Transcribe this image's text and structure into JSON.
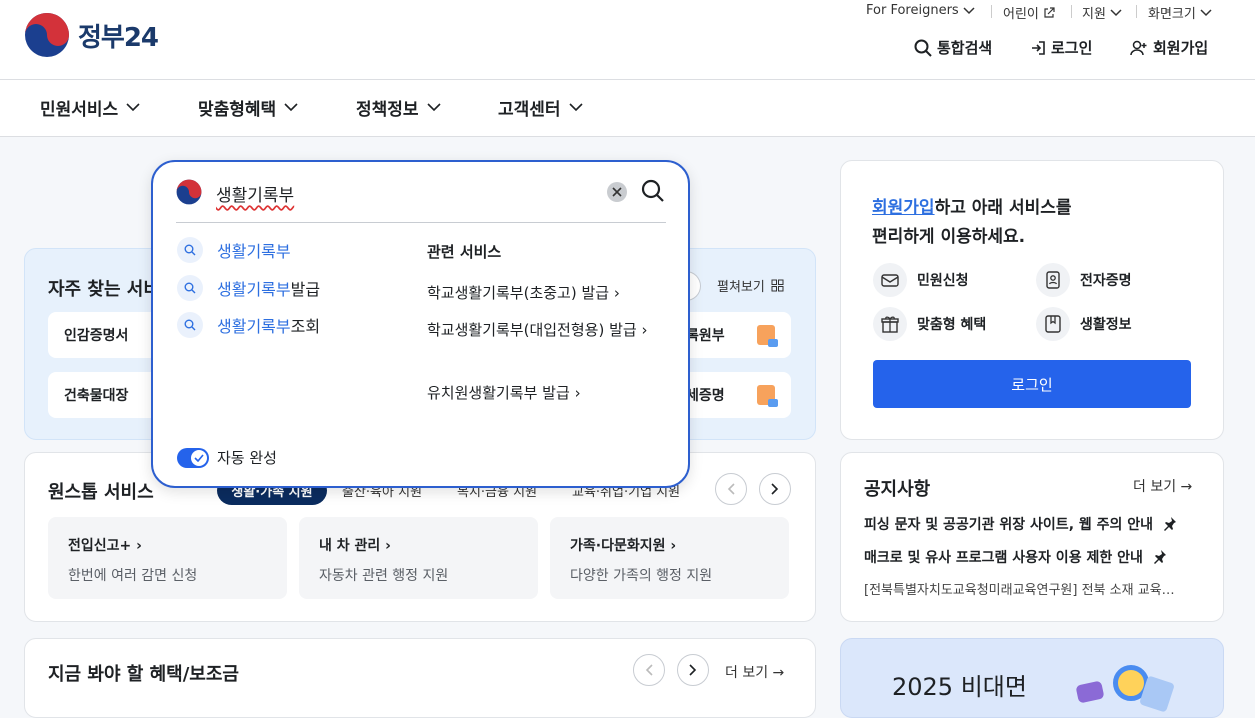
{
  "header": {
    "logo_text": "정부24",
    "util": {
      "foreigners": "For Foreigners",
      "kids": "어린이",
      "support": "지원",
      "screen_size": "화면크기"
    },
    "search_label": "통합검색",
    "login_label": "로그인",
    "signup_label": "회원가입"
  },
  "gnb": {
    "items": [
      "민원서비스",
      "맞춤형혜택",
      "정책정보",
      "고객센터"
    ]
  },
  "frequent": {
    "title": "자주 찾는 서비",
    "expand_label": "펼쳐보기",
    "chips_left": [
      "인감증명서",
      "건축물대장"
    ],
    "chips_right": [
      "록원부",
      "세증명"
    ]
  },
  "onestop": {
    "title": "원스톱 서비스",
    "tabs": [
      "생활·가족 지원",
      "출산·육아 지원",
      "복지·금융 지원",
      "교육·취업·기업 지원"
    ],
    "cards": [
      {
        "title": "전입신고+",
        "desc": "한번에 여러 감면 신청"
      },
      {
        "title": "내 차 관리",
        "desc": "자동차 관련 행정 지원"
      },
      {
        "title": "가족·다문화지원",
        "desc": "다양한 가족의 행정 지원"
      }
    ]
  },
  "benefit": {
    "title": "지금 봐야 할 혜택/보조금",
    "more_label": "더 보기"
  },
  "member": {
    "link_text": "회원가입",
    "line1_rest": "하고 아래 서비스를",
    "line2": "편리하게 이용하세요.",
    "services": [
      "민원신청",
      "전자증명",
      "맞춤형 혜택",
      "생활정보"
    ],
    "login_button": "로그인"
  },
  "notice": {
    "title": "공지사항",
    "more_label": "더 보기",
    "items": [
      "피싱 문자 및 공공기관 위장 사이트, 웹 주의 안내",
      "매크로 및 유사 프로그램 사용자 이용 제한 안내",
      "[전북특별자치도교육청미래교육연구원] 전북 소재 교육…"
    ]
  },
  "banner": {
    "text": "2025 비대면"
  },
  "search": {
    "query": "생활기록부",
    "suggestions": [
      {
        "match": "생활기록부",
        "rest": ""
      },
      {
        "match": "생활기록부",
        "rest": "발급"
      },
      {
        "match": "생활기록부",
        "rest": "조회"
      }
    ],
    "related_title": "관련 서비스",
    "related": [
      "학교생활기록부(초중고) 발급",
      "학교생활기록부(대입전형용) 발급",
      "유치원생활기록부 발급"
    ],
    "autocomplete_label": "자동 완성",
    "autocomplete_on": true
  },
  "colors": {
    "primary": "#2563eb",
    "link": "#2d6fe0",
    "navy": "#0b2c5f",
    "frequent_bg": "#e7f1fc"
  }
}
